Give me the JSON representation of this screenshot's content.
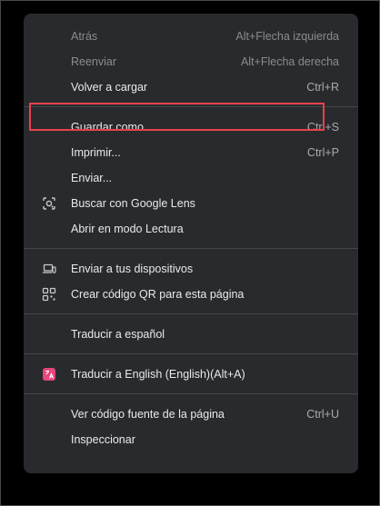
{
  "menu": {
    "items": [
      {
        "label": "Atrás",
        "shortcut": "Alt+Flecha izquierda",
        "disabled": true
      },
      {
        "label": "Reenviar",
        "shortcut": "Alt+Flecha derecha",
        "disabled": true
      },
      {
        "label": "Volver a cargar",
        "shortcut": "Ctrl+R"
      },
      {
        "label": "Guardar como...",
        "shortcut": "Ctrl+S",
        "highlighted": true
      },
      {
        "label": "Imprimir...",
        "shortcut": "Ctrl+P"
      },
      {
        "label": "Enviar..."
      },
      {
        "label": "Buscar con Google Lens",
        "icon": "google-lens-icon"
      },
      {
        "label": "Abrir en modo Lectura"
      },
      {
        "label": "Enviar a tus dispositivos",
        "icon": "devices-icon"
      },
      {
        "label": "Crear código QR para esta página",
        "icon": "qr-code-icon"
      },
      {
        "label": "Traducir a español"
      },
      {
        "label": "Traducir a English (English)(Alt+A)",
        "icon": "translate-app-icon"
      },
      {
        "label": "Ver código fuente de la página",
        "shortcut": "Ctrl+U"
      },
      {
        "label": "Inspeccionar"
      }
    ]
  },
  "colors": {
    "menu_background": "#292a2d",
    "highlight_border": "#e8414d",
    "translate_icon": "#e8467c"
  }
}
